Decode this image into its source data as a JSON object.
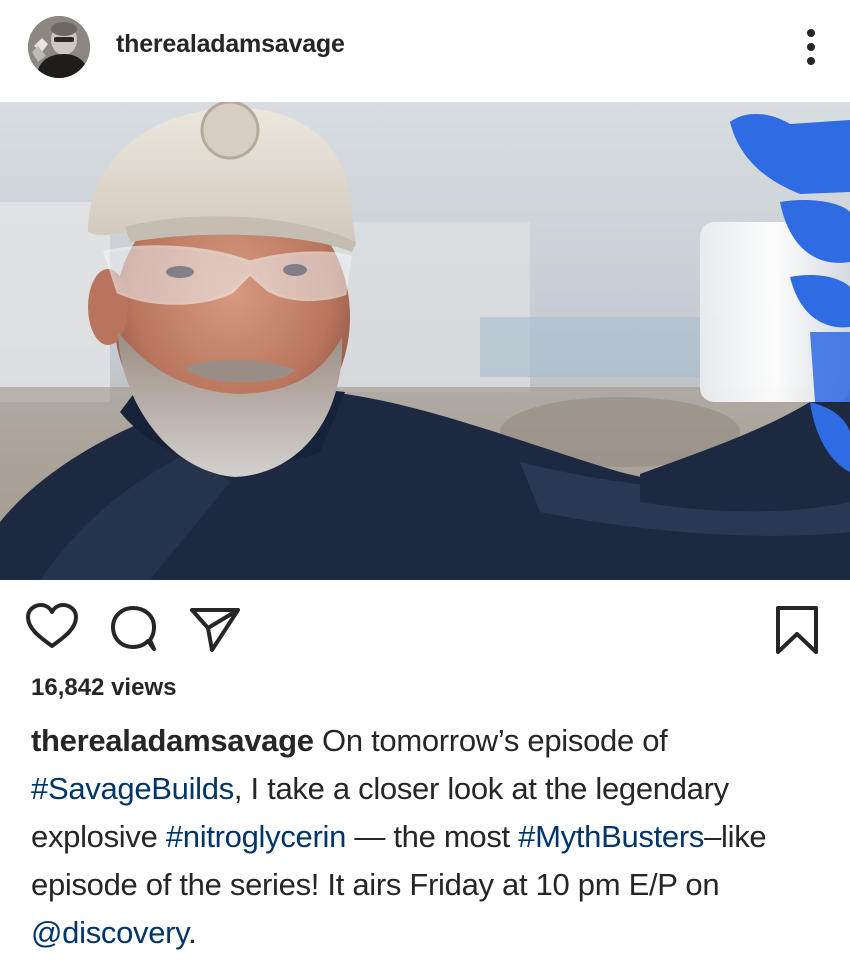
{
  "header": {
    "username": "therealadamsavage",
    "avatar_icon": "avatar-photo",
    "more_icon": "more-vertical-icon"
  },
  "post": {
    "image_alt": "photo-of-man-in-cap-and-safety-glasses-holding-vial",
    "actions": {
      "like_icon": "heart-icon",
      "comment_icon": "comment-icon",
      "share_icon": "send-icon",
      "save_icon": "bookmark-icon"
    },
    "views": "16,842 views",
    "caption": {
      "username": "therealadamsavage",
      "text_1": " On tomorrow’s episode of ",
      "hashtag_1": "#SavageBuilds",
      "text_2": ", I take a closer look at the legendary explosive ",
      "hashtag_2": "#nitroglycerin",
      "text_3": " — the most ",
      "hashtag_3": "#MythBusters",
      "text_4": "–like episode of the series! It airs Friday at 10 pm E/P on ",
      "mention": "@discovery",
      "text_5": "."
    }
  },
  "colors": {
    "text": "#262626",
    "link": "#003569",
    "background": "#ffffff"
  }
}
